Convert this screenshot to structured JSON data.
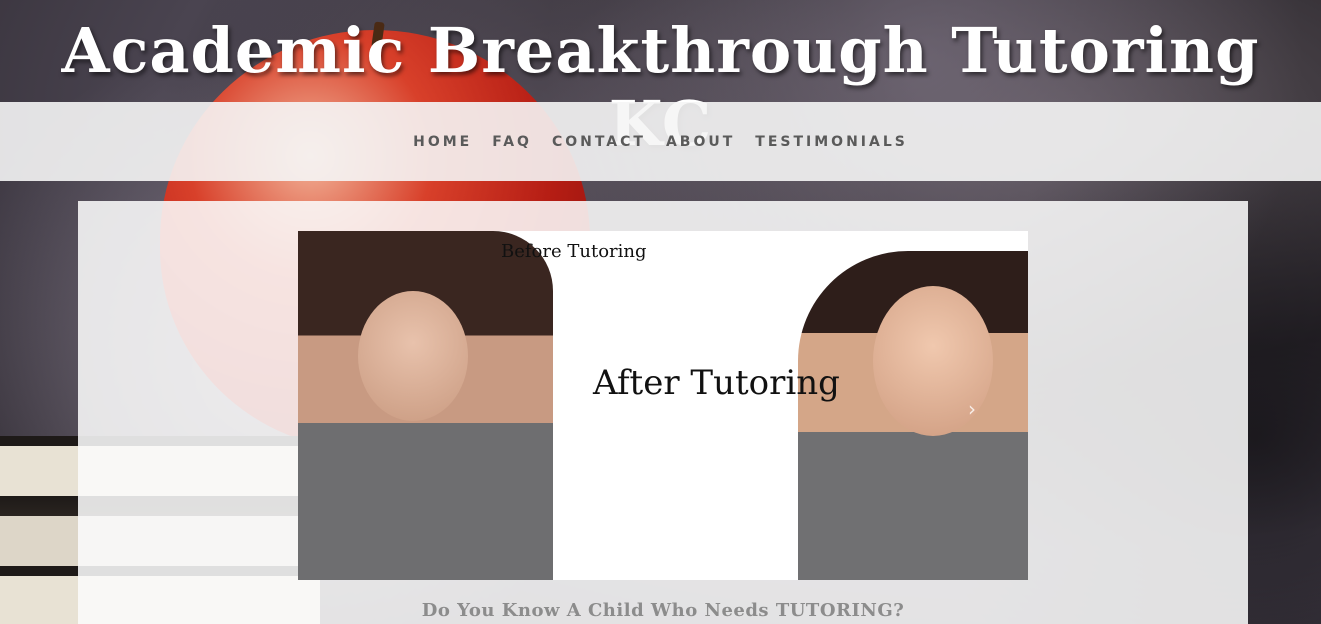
{
  "site": {
    "title": "Academic Breakthrough Tutoring KC"
  },
  "nav": {
    "items": [
      {
        "label": "HOME"
      },
      {
        "label": "FAQ"
      },
      {
        "label": "CONTACT"
      },
      {
        "label": "ABOUT"
      },
      {
        "label": "TESTIMONIALS"
      }
    ]
  },
  "slider": {
    "caption_before": "Before Tutoring",
    "caption_after": "After Tutoring",
    "next_icon": "›"
  },
  "main": {
    "tagline": "Do You Know A Child Who Needs TUTORING?"
  },
  "colors": {
    "nav_text": "#5a5a5a",
    "title_text": "#ffffff",
    "tagline_text": "#8c8c8c"
  }
}
